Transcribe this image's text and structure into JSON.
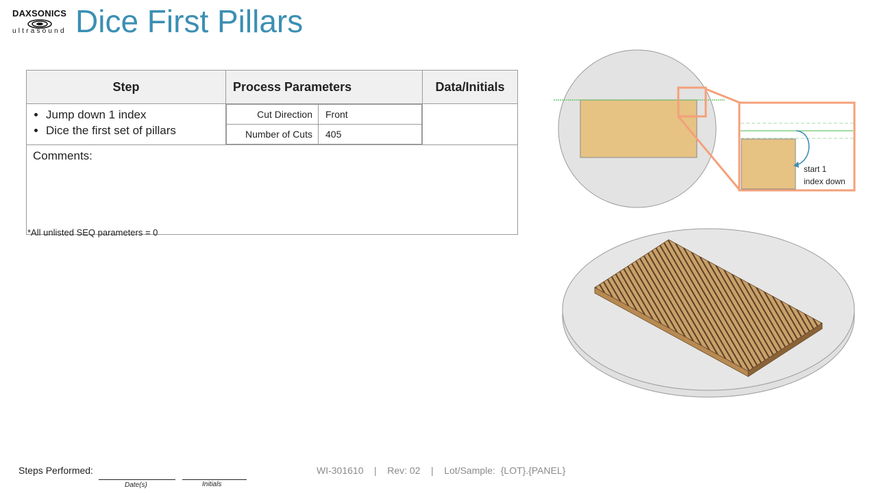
{
  "logo": {
    "brand": "DAXSONICS",
    "sub": "ultrasound"
  },
  "title": "Dice First Pillars",
  "table": {
    "headers": {
      "step": "Step",
      "process": "Process Parameters",
      "data": "Data/Initials"
    },
    "steps": [
      "Jump down 1 index",
      "Dice the first set of pillars"
    ],
    "params": [
      {
        "label": "Cut Direction",
        "value": "Front"
      },
      {
        "label": "Number of Cuts",
        "value": "405"
      }
    ],
    "comments_label": "Comments:"
  },
  "note": "*All unlisted SEQ parameters = 0",
  "figure": {
    "callout": [
      "start 1",
      "index down"
    ]
  },
  "footer": {
    "steps_performed": "Steps Performed:",
    "dates_label": "Date(s)",
    "initials_label": "Initials",
    "doc_info": "WI-301610    |    Rev: 02    |    Lot/Sample:  {LOT}.{PANEL}"
  },
  "colors": {
    "title": "#3b8fb3",
    "callout": "#f4a07a",
    "substrate": "#e6c283",
    "guide_line": "#6cc66a",
    "arrow": "#3b8fb3"
  }
}
